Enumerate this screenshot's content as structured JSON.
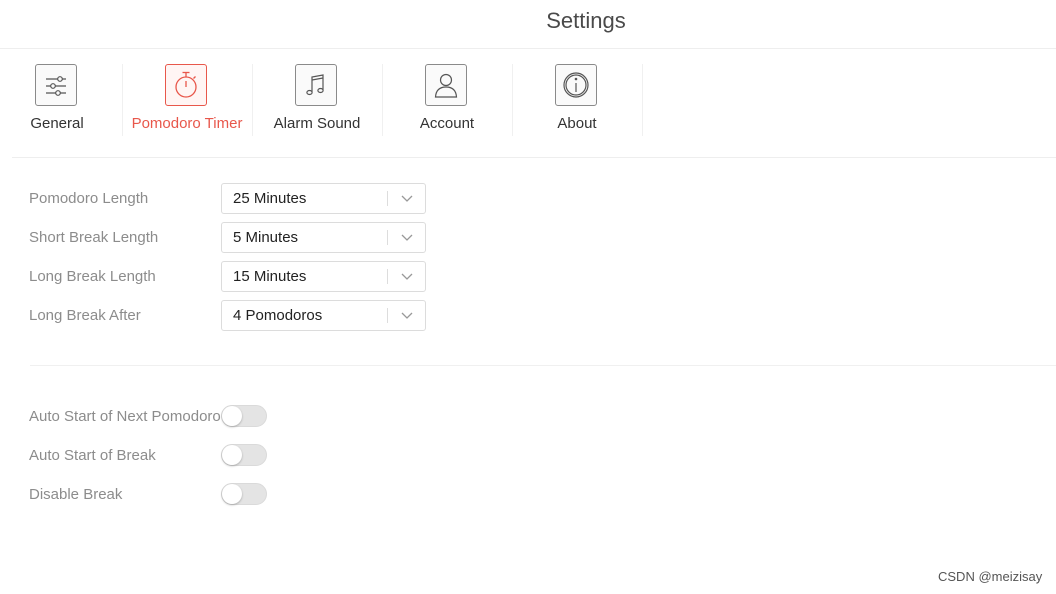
{
  "window": {
    "title": "Settings"
  },
  "tabs": [
    {
      "label": "General",
      "icon": "sliders-icon",
      "active": false
    },
    {
      "label": "Pomodoro Timer",
      "icon": "stopwatch-icon",
      "active": true
    },
    {
      "label": "Alarm Sound",
      "icon": "music-note-icon",
      "active": false
    },
    {
      "label": "Account",
      "icon": "user-icon",
      "active": false
    },
    {
      "label": "About",
      "icon": "info-icon",
      "active": false
    }
  ],
  "timer_settings": [
    {
      "label": "Pomodoro Length",
      "value": "25 Minutes"
    },
    {
      "label": "Short Break Length",
      "value": "5 Minutes"
    },
    {
      "label": "Long Break Length",
      "value": "15 Minutes"
    },
    {
      "label": "Long Break After",
      "value": "4 Pomodoros"
    }
  ],
  "toggles": [
    {
      "label": "Auto Start of Next Pomodoro",
      "on": false
    },
    {
      "label": "Auto Start of Break",
      "on": false
    },
    {
      "label": "Disable Break",
      "on": false
    }
  ],
  "colors": {
    "accent": "#e8574b",
    "label_gray": "#8c8c8c",
    "toggle_off": "#e4e4e4"
  },
  "watermark": "CSDN @meizisay"
}
